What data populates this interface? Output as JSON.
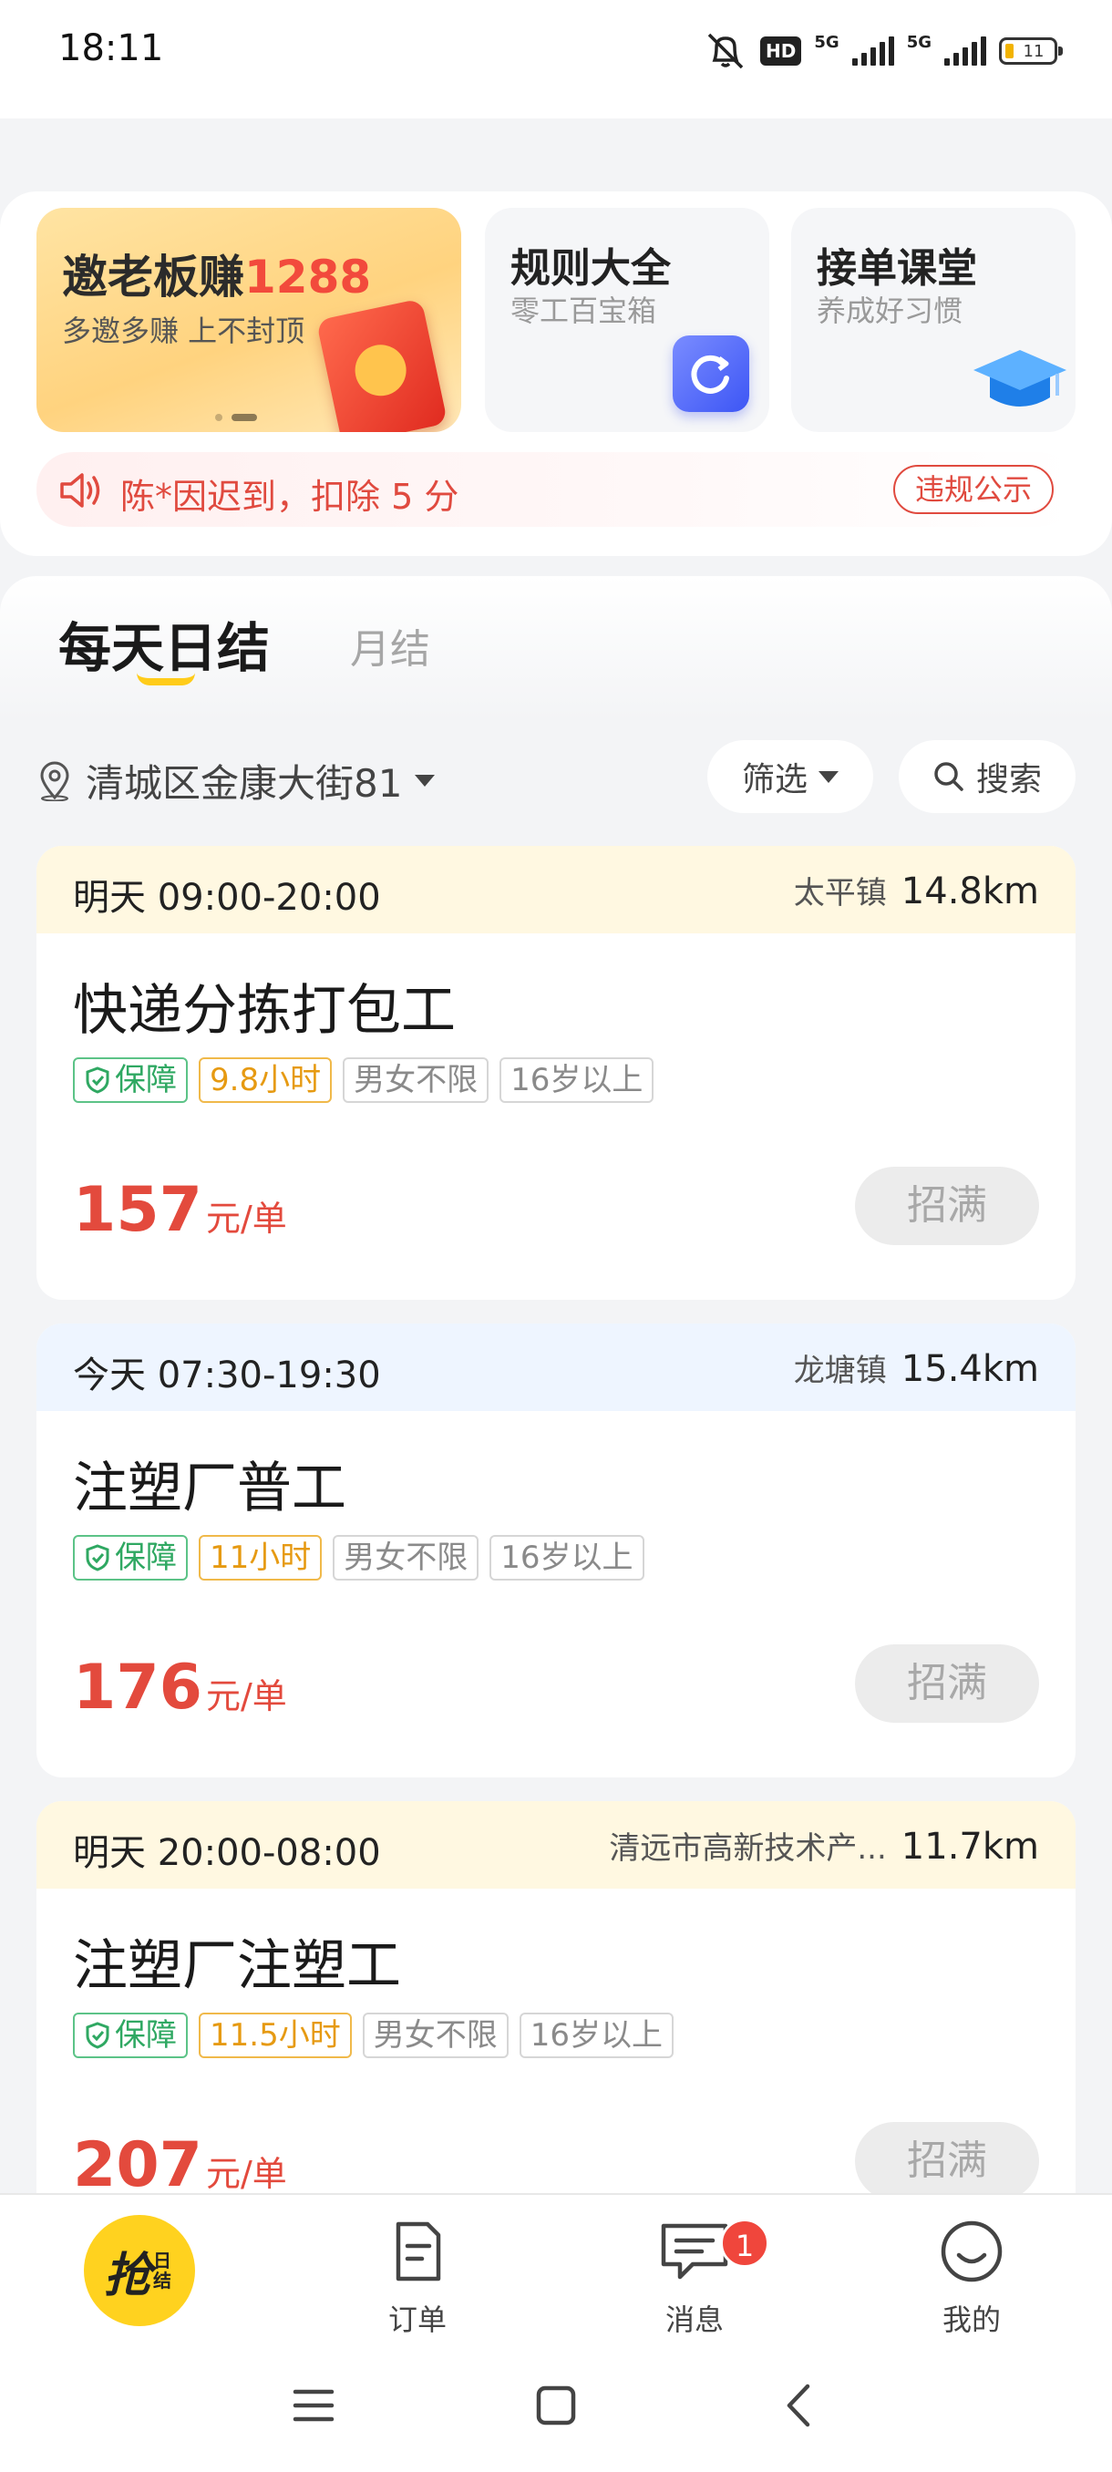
{
  "status_bar": {
    "time": "18:11",
    "hd": "HD",
    "net1": "5G",
    "net2": "5G",
    "battery": "11"
  },
  "feature_cards": {
    "promo": {
      "title_prefix": "邀老板赚",
      "title_highlight": "1288",
      "subtitle": "多邀多赚 上不封顶"
    },
    "rules": {
      "title": "规则大全",
      "subtitle": "零工百宝箱"
    },
    "class": {
      "title": "接单课堂",
      "subtitle": "养成好习惯"
    }
  },
  "notice": {
    "text": "陈*因迟到，扣除 5 分",
    "button": "违规公示"
  },
  "tabs": [
    {
      "label": "每天日结",
      "active": true
    },
    {
      "label": "月结",
      "active": false
    }
  ],
  "filters": {
    "location": "清城区金康大街81",
    "filter_label": "筛选",
    "search_label": "搜索"
  },
  "jobs": [
    {
      "time": "明天 09:00-20:00",
      "town": "太平镇",
      "distance": "14.8km",
      "title": "快递分拣打包工",
      "tags": [
        "保障",
        "9.8小时",
        "男女不限",
        "16岁以上"
      ],
      "price": "157",
      "unit": "元/单",
      "button": "招满",
      "head_color": "yellow"
    },
    {
      "time": "今天 07:30-19:30",
      "town": "龙塘镇",
      "distance": "15.4km",
      "title": "注塑厂普工",
      "tags": [
        "保障",
        "11小时",
        "男女不限",
        "16岁以上"
      ],
      "price": "176",
      "unit": "元/单",
      "button": "招满",
      "head_color": "blue"
    },
    {
      "time": "明天 20:00-08:00",
      "town": "清远市高新技术产...",
      "distance": "11.7km",
      "title": "注塑厂注塑工",
      "tags": [
        "保障",
        "11.5小时",
        "男女不限",
        "16岁以上"
      ],
      "price": "207",
      "unit": "元/单",
      "button": "招满",
      "head_color": "yellow"
    }
  ],
  "bottom_nav": {
    "grab": {
      "big": "抢",
      "small": "日结"
    },
    "orders": "订单",
    "messages": "消息",
    "messages_badge": "1",
    "mine": "我的"
  },
  "colors": {
    "accent_yellow": "#ffd21f",
    "price_red": "#e34a3d",
    "tag_green": "#2fa862",
    "tag_orange": "#e69a12"
  }
}
